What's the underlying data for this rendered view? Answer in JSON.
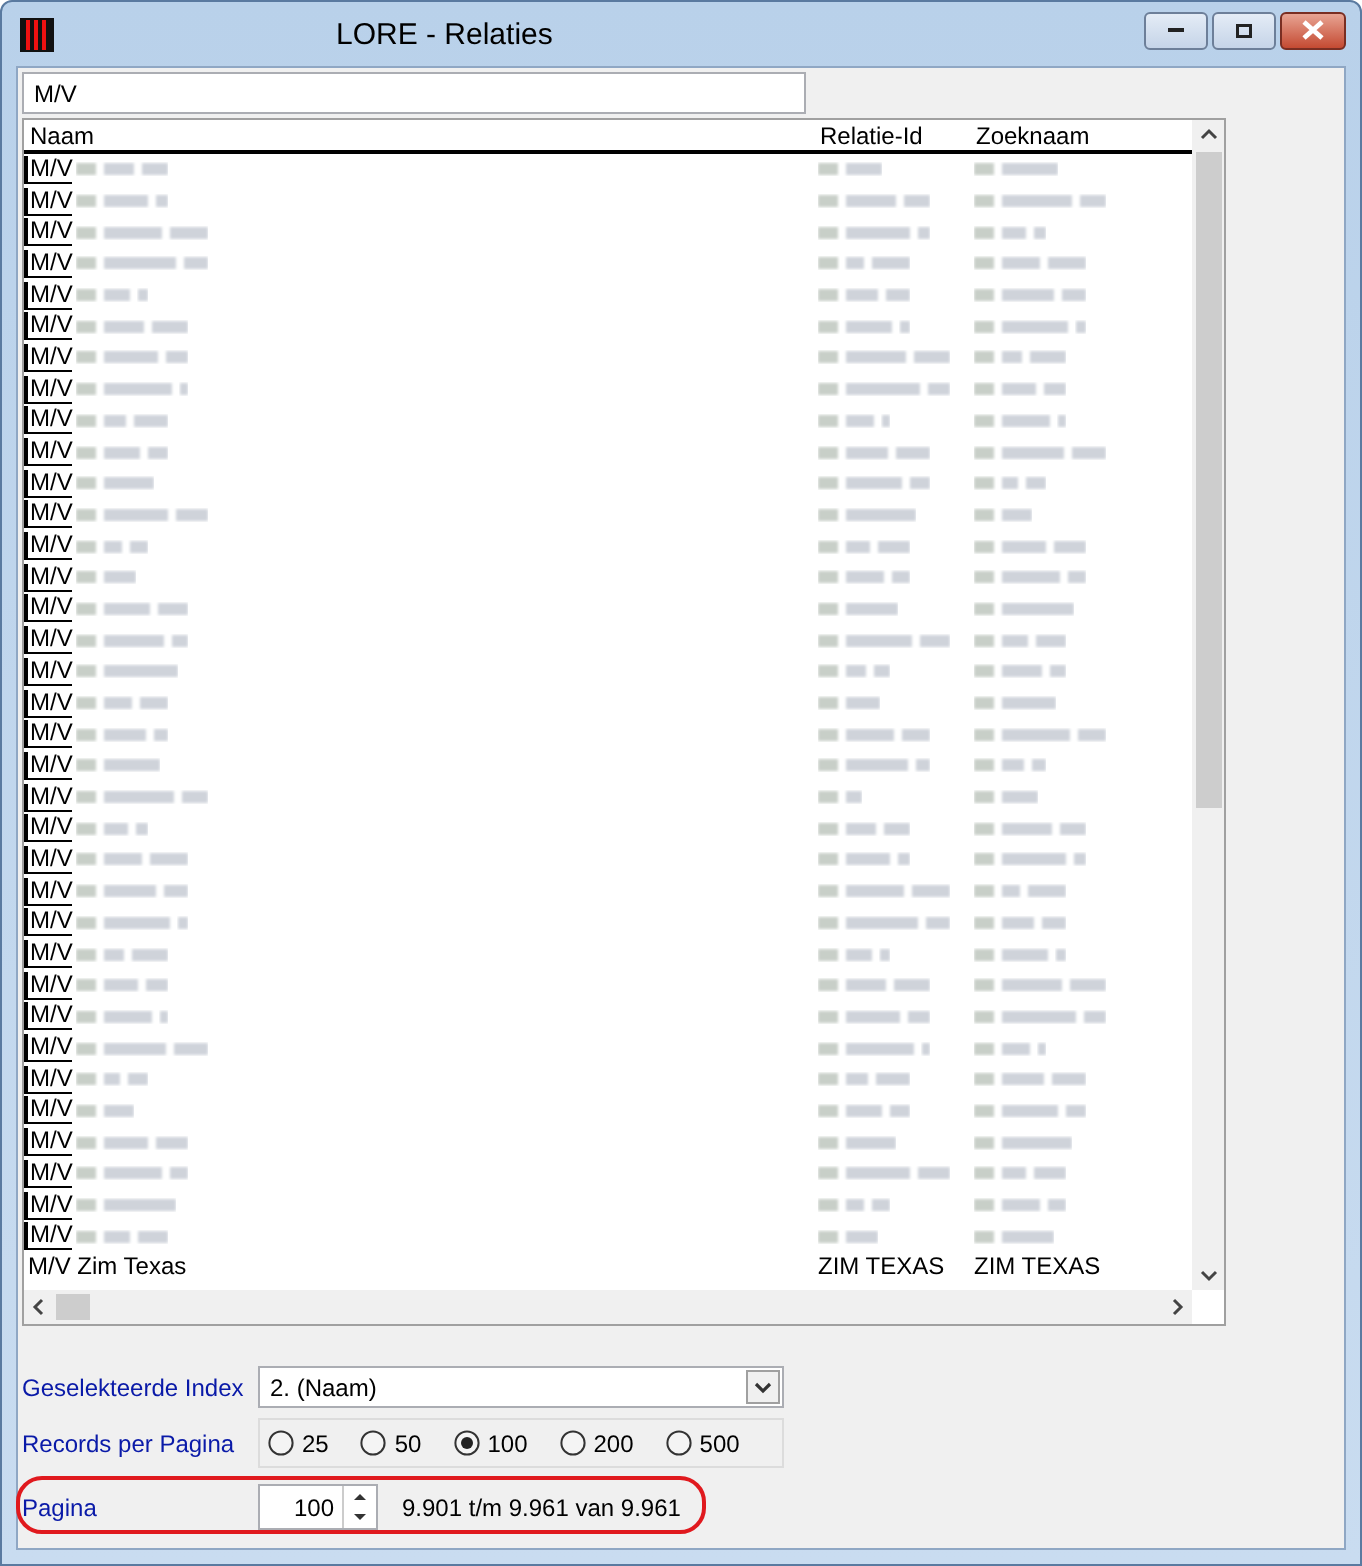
{
  "window": {
    "title": "LORE - Relaties"
  },
  "search": {
    "value": "M/V"
  },
  "table": {
    "columns": [
      "Naam",
      "Relatie-Id",
      "Zoeknaam"
    ],
    "rows": [
      {
        "kind": "blurred",
        "naam": "M/V"
      },
      {
        "kind": "blurred",
        "naam": "M/V"
      },
      {
        "kind": "blurred",
        "naam": "M/V"
      },
      {
        "kind": "blurred",
        "naam": "M/V"
      },
      {
        "kind": "blurred",
        "naam": "M/V"
      },
      {
        "kind": "blurred",
        "naam": "M/V"
      },
      {
        "kind": "blurred",
        "naam": "M/V"
      },
      {
        "kind": "blurred",
        "naam": "M/V"
      },
      {
        "kind": "blurred",
        "naam": "M/V"
      },
      {
        "kind": "blurred",
        "naam": "M/V"
      },
      {
        "kind": "blurred",
        "naam": "M/V"
      },
      {
        "kind": "blurred",
        "naam": "M/V"
      },
      {
        "kind": "blurred",
        "naam": "M/V"
      },
      {
        "kind": "blurred",
        "naam": "M/V"
      },
      {
        "kind": "blurred",
        "naam": "M/V"
      },
      {
        "kind": "blurred",
        "naam": "M/V"
      },
      {
        "kind": "blurred",
        "naam": "M/V"
      },
      {
        "kind": "blurred",
        "naam": "M/V"
      },
      {
        "kind": "blurred",
        "naam": "M/V"
      },
      {
        "kind": "blurred",
        "naam": "M/V"
      },
      {
        "kind": "blurred",
        "naam": "M/V"
      },
      {
        "kind": "blurred",
        "naam": "M/V"
      },
      {
        "kind": "blurred",
        "naam": "M/V"
      },
      {
        "kind": "blurred",
        "naam": "M/V"
      },
      {
        "kind": "blurred",
        "naam": "M/V"
      },
      {
        "kind": "blurred",
        "naam": "M/V"
      },
      {
        "kind": "blurred",
        "naam": "M/V"
      },
      {
        "kind": "blurred",
        "naam": "M/V"
      },
      {
        "kind": "blurred",
        "naam": "M/V"
      },
      {
        "kind": "blurred",
        "naam": "M/V"
      },
      {
        "kind": "blurred",
        "naam": "M/V"
      },
      {
        "kind": "blurred",
        "naam": "M/V"
      },
      {
        "kind": "blurred",
        "naam": "M/V"
      },
      {
        "kind": "blurred",
        "naam": "M/V"
      },
      {
        "kind": "blurred",
        "naam": "M/V"
      },
      {
        "kind": "plain",
        "naam": "M/V Zim Texas",
        "relatie_id": "ZIM TEXAS",
        "zoeknaam": "ZIM TEXAS"
      }
    ]
  },
  "index_select": {
    "label": "Geselekteerde Index",
    "value": "2. (Naam)"
  },
  "records_per_page": {
    "label": "Records per Pagina",
    "options": [
      {
        "label": "25",
        "selected": false
      },
      {
        "label": "50",
        "selected": false
      },
      {
        "label": "100",
        "selected": true
      },
      {
        "label": "200",
        "selected": false
      },
      {
        "label": "500",
        "selected": false
      }
    ]
  },
  "page": {
    "label": "Pagina",
    "value": "100",
    "range": "9.901 t/m 9.961 van 9.961",
    "highlighted": true
  }
}
